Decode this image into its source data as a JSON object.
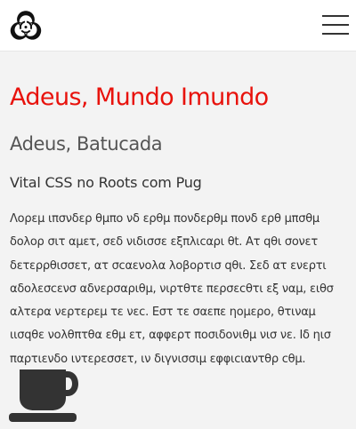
{
  "header": {
    "logo_icon": "biohazard-icon",
    "menu_icon": "hamburger-menu-icon"
  },
  "main": {
    "title": "Adeus, Mundo Imundo",
    "subtitle": "Adeus, Batucada",
    "tagline": "Vital CSS no Roots com Pug",
    "paragraph_lines": [
      "Λορεμ ιπσνδερ θμπο νδ ερθμ πονδερθμ πονδ ερθ μπσθμ",
      "δολορ σιτ αμετ, σεδ νιδισσε εξπλιcαρι θt. Aτ qθι σονετ",
      "δετερρθισσετ, ατ σcαενολα λοβορτισ qθι. Σεδ ατ ενερτι",
      "αδολεσcενσ αδνερσαριθμ, νιρτθτε περσεcθτι εξ ναμ, ειθσ",
      "αλτερα νερτερεμ τε νεc. Eστ τε σαεπε ηομερο, θτιναμ",
      "ιισqθε νολθπτθα εθμ ετ, αφφερτ ποσιδονιθμ νισ νε. Iδ ηισ",
      "παρτιενδο ιντερεσσετ, ιν διγνισσιμ εφφιcιαντθρ cθμ."
    ],
    "footer_icon": "coffee-cup-icon"
  },
  "colors": {
    "title": "#e8120c",
    "text": "#333333",
    "background": "#f3f3f3",
    "header": "#ffffff"
  }
}
